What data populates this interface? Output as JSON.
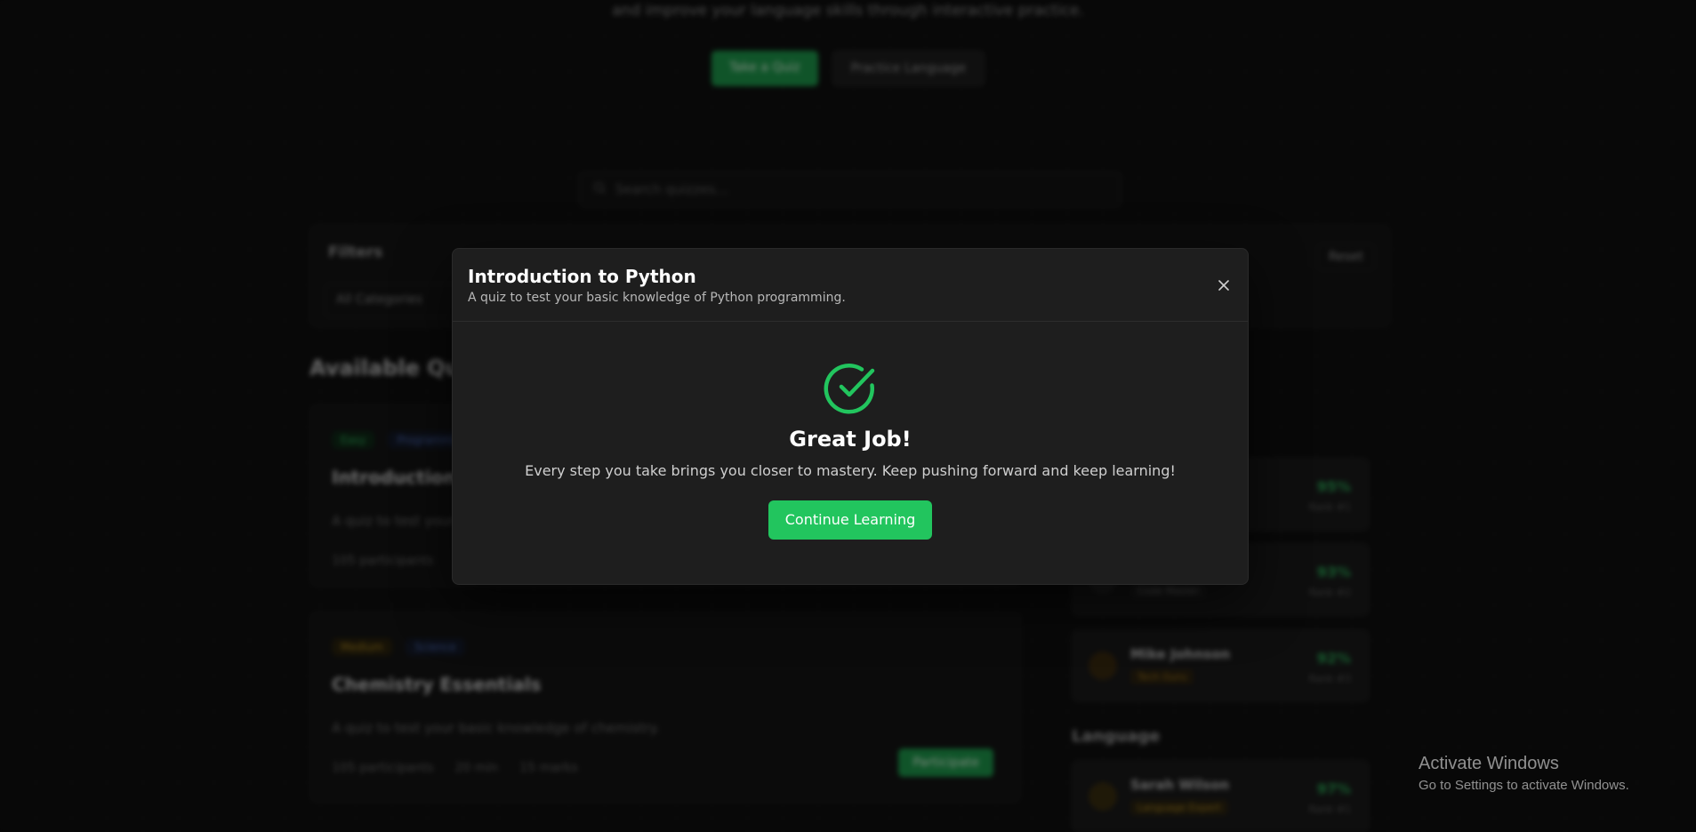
{
  "background": {
    "hero_subtitle": "and improve your language skills through interactive practice.",
    "hero_buttons": [
      "Take a Quiz",
      "Practice Language"
    ],
    "search_placeholder": "Search quizzes...",
    "filters": {
      "title": "Filters",
      "reset_label": "Reset",
      "category_select": "All Categories"
    },
    "section_title": "Available Quizzes",
    "quiz_cards": [
      {
        "difficulty": "Easy",
        "category": "Programming",
        "title": "Introduction to Python",
        "description": "A quiz to test your basic knowledge of Python programming.",
        "participants": "105 participants"
      },
      {
        "difficulty": "Medium",
        "category": "Science",
        "title": "Chemistry Essentials",
        "description": "A quiz to test your basic knowledge of chemistry.",
        "participants": "105 participants",
        "duration": "20 min",
        "questions": "15 marks",
        "action": "Participate"
      }
    ],
    "leaderboard": [
      {
        "name": "",
        "badge": "",
        "score": "95%",
        "rank": "Rank #1"
      },
      {
        "name": "",
        "badge": "Code Master",
        "score": "93%",
        "rank": "Rank #2"
      },
      {
        "name": "Mike Johnson",
        "badge": "Tech Guru",
        "score": "92%",
        "rank": "Rank #3"
      }
    ],
    "language_section": "Language",
    "language_leaderboard": [
      {
        "name": "Sarah Wilson",
        "badge": "Language Expert",
        "score": "97%",
        "rank": "Rank #1"
      }
    ]
  },
  "modal": {
    "title": "Introduction to Python",
    "subtitle": "A quiz to test your basic knowledge of Python programming.",
    "result_title": "Great Job!",
    "result_message": "Every step you take brings you closer to mastery. Keep pushing forward and keep learning!",
    "continue_label": "Continue Learning",
    "icon": "check-circle-icon",
    "accent_color": "#22c55e"
  },
  "watermark": {
    "title": "Activate Windows",
    "subtitle": "Go to Settings to activate Windows."
  }
}
